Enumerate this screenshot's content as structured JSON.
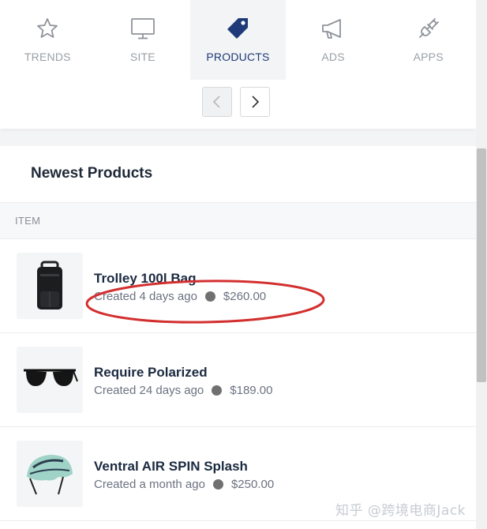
{
  "colors": {
    "active_tab": "#1e3a78",
    "inactive_tab": "#9aa0a6",
    "annotation": "#d32f2f"
  },
  "tabs": [
    {
      "label": "TRENDS",
      "icon": "star-icon",
      "active": false
    },
    {
      "label": "SITE",
      "icon": "monitor-icon",
      "active": false
    },
    {
      "label": "PRODUCTS",
      "icon": "tag-icon",
      "active": true
    },
    {
      "label": "ADS",
      "icon": "megaphone-icon",
      "active": false
    },
    {
      "label": "APPS",
      "icon": "plug-icon",
      "active": false
    }
  ],
  "pager": {
    "prev_icon": "chevron-left-icon",
    "next_icon": "chevron-right-icon"
  },
  "products": {
    "title": "Newest Products",
    "column_header": "ITEM",
    "items": [
      {
        "name": "Trolley 100l Bag",
        "created": "Created 4 days ago",
        "price": "$260.00",
        "image": "backpack"
      },
      {
        "name": "Require Polarized",
        "created": "Created 24 days ago",
        "price": "$189.00",
        "image": "sunglasses"
      },
      {
        "name": "Ventral AIR SPIN Splash",
        "created": "Created a month ago",
        "price": "$250.00",
        "image": "bike-helmet"
      }
    ]
  },
  "watermark": "知乎 @跨境电商Jack"
}
